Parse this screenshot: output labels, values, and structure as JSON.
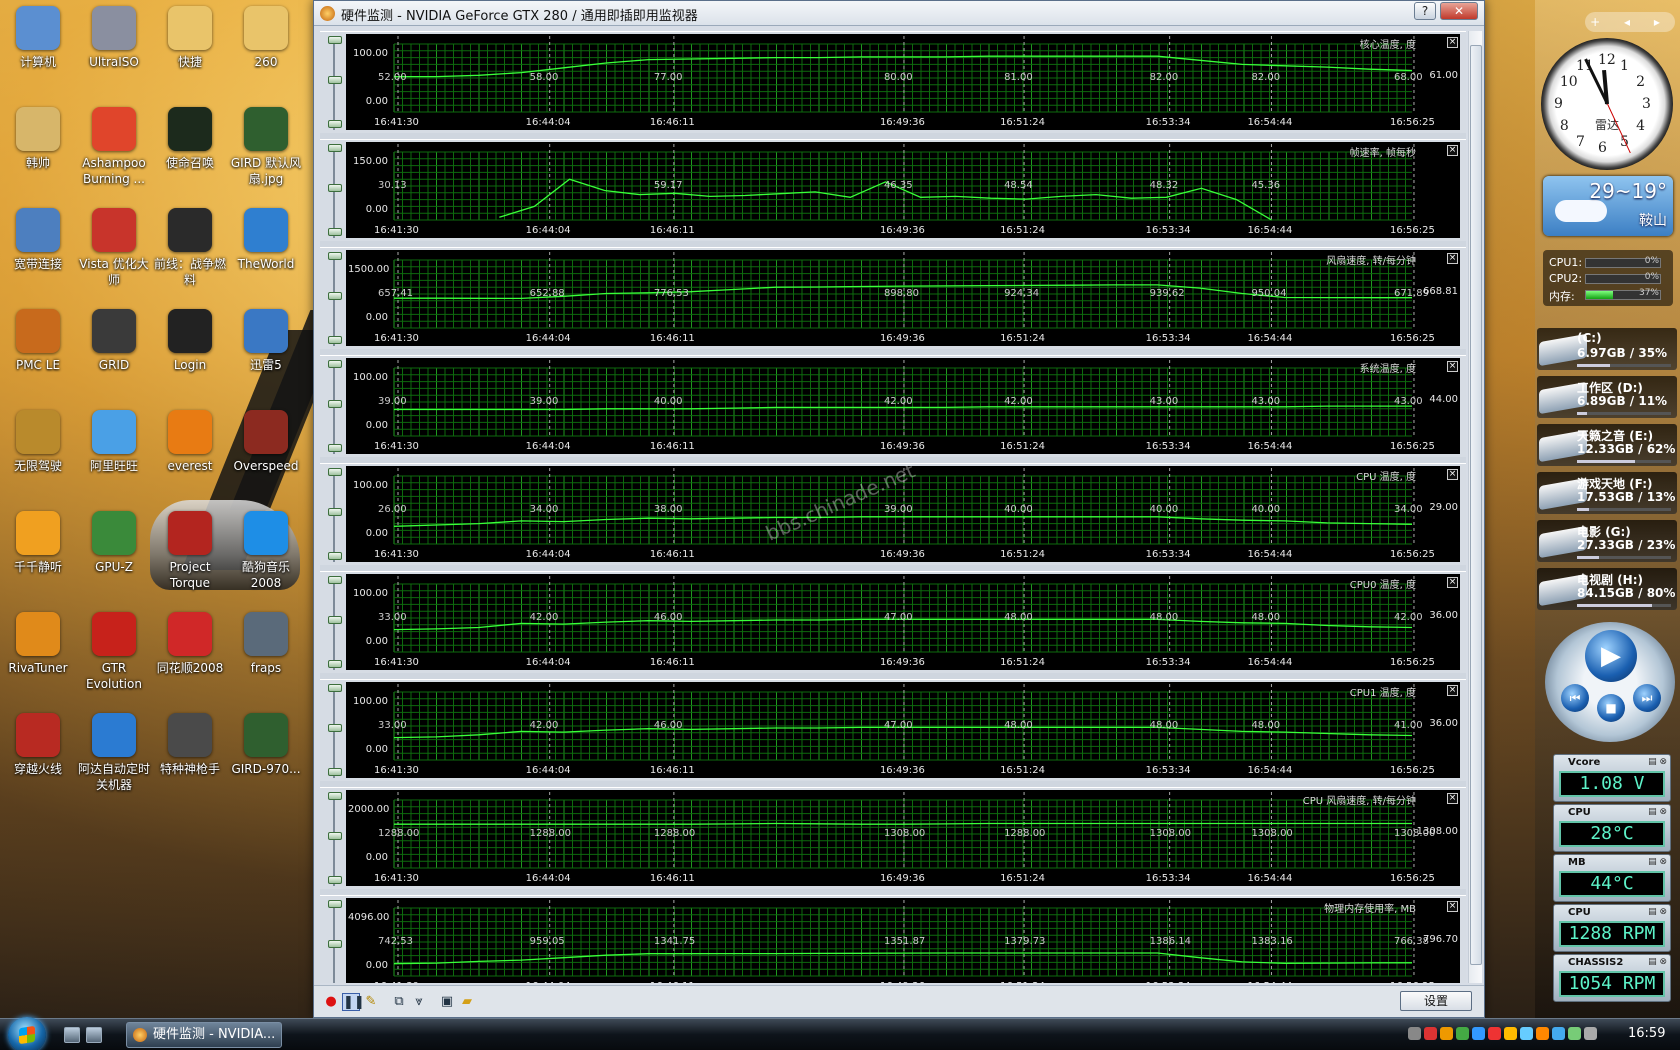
{
  "window": {
    "title": "硬件监测 - NVIDIA GeForce GTX 280 / 通用即插即用监视器",
    "help_label": "?",
    "close_label": "✕",
    "settings_label": "设置"
  },
  "x_ticks": [
    "16:41:30",
    "16:44:04",
    "16:46:11",
    "16:49:36",
    "16:51:24",
    "16:53:34",
    "16:54:44",
    "16:56:25"
  ],
  "panels": [
    {
      "label": "核心温度, 度",
      "ymax": "100.00",
      "ymin": "0.00",
      "max_value": 100,
      "last": "61.00",
      "values": [
        "52.00",
        "58.00",
        "77.00",
        "80.00",
        "81.00",
        "82.00",
        "82.00",
        "68.00"
      ],
      "series": [
        52,
        52,
        54,
        58,
        65,
        72,
        77,
        78,
        79,
        80,
        80,
        81,
        81,
        81,
        82,
        82,
        82,
        82,
        82,
        76,
        70,
        68,
        66,
        63,
        61
      ]
    },
    {
      "label": "帧速率, 帧每秒",
      "ymax": "150.00",
      "ymin": "0.00",
      "max_value": 150,
      "last": "",
      "values": [
        "30.13",
        "",
        "59.17",
        "46.35",
        "48.54",
        "48.32",
        "45.36",
        ""
      ],
      "series": [
        null,
        null,
        null,
        6,
        30,
        90,
        65,
        56,
        59,
        52,
        54,
        58,
        62,
        50,
        84,
        50,
        52,
        48,
        46,
        52,
        56,
        48,
        50,
        70,
        45,
        0,
        null,
        null,
        null,
        null
      ]
    },
    {
      "label": "风扇速度, 转/每分钟",
      "ymax": "1500.00",
      "ymin": "0.00",
      "max_value": 1500,
      "last": "668.81",
      "values": [
        "657.41",
        "652.88",
        "776.53",
        "898.80",
        "924.34",
        "939.62",
        "950.04",
        "671.89"
      ],
      "series": [
        657,
        657,
        655,
        652,
        700,
        760,
        776,
        800,
        850,
        899,
        905,
        915,
        924,
        928,
        935,
        940,
        945,
        950,
        950,
        880,
        760,
        672,
        670,
        669,
        669
      ]
    },
    {
      "label": "系统温度, 度",
      "ymax": "100.00",
      "ymin": "0.00",
      "max_value": 100,
      "last": "44.00",
      "values": [
        "39.00",
        "39.00",
        "40.00",
        "42.00",
        "42.00",
        "43.00",
        "43.00",
        "43.00"
      ],
      "series": [
        39,
        39,
        39,
        39,
        39,
        40,
        40,
        40,
        41,
        42,
        42,
        42,
        42,
        42,
        43,
        43,
        43,
        43,
        43,
        43,
        43,
        43,
        44,
        44,
        44
      ]
    },
    {
      "label": "CPU 温度, 度",
      "ymax": "100.00",
      "ymin": "0.00",
      "max_value": 100,
      "last": "29.00",
      "values": [
        "26.00",
        "34.00",
        "38.00",
        "39.00",
        "40.00",
        "40.00",
        "40.00",
        "34.00"
      ],
      "series": [
        26,
        28,
        30,
        34,
        33,
        36,
        38,
        37,
        38,
        39,
        39,
        40,
        40,
        40,
        40,
        40,
        40,
        40,
        40,
        37,
        35,
        34,
        31,
        30,
        29
      ]
    },
    {
      "label": "CPU0 温度, 度",
      "ymax": "100.00",
      "ymin": "0.00",
      "max_value": 100,
      "last": "36.00",
      "values": [
        "33.00",
        "42.00",
        "46.00",
        "47.00",
        "48.00",
        "48.00",
        "48.00",
        "42.00"
      ],
      "series": [
        33,
        34,
        36,
        42,
        41,
        44,
        46,
        45,
        46,
        47,
        47,
        48,
        48,
        48,
        48,
        48,
        48,
        48,
        48,
        45,
        43,
        42,
        39,
        37,
        36
      ]
    },
    {
      "label": "CPU1 温度, 度",
      "ymax": "100.00",
      "ymin": "0.00",
      "max_value": 100,
      "last": "36.00",
      "values": [
        "33.00",
        "42.00",
        "46.00",
        "47.00",
        "48.00",
        "48.00",
        "48.00",
        "41.00"
      ],
      "series": [
        33,
        34,
        37,
        42,
        41,
        44,
        46,
        45,
        46,
        47,
        47,
        48,
        48,
        48,
        48,
        48,
        48,
        48,
        48,
        45,
        42,
        41,
        39,
        37,
        36
      ]
    },
    {
      "label": "CPU 风扇速度, 转/每分钟",
      "ymax": "2000.00",
      "ymin": "0.00",
      "max_value": 2000,
      "last": "1308.00",
      "values": [
        "1288.00",
        "1288.00",
        "1288.00",
        "1308.00",
        "1288.00",
        "1308.00",
        "1308.00",
        "1308.00"
      ],
      "series": [
        1288,
        1288,
        1288,
        1288,
        1288,
        1288,
        1288,
        1288,
        1298,
        1308,
        1300,
        1288,
        1288,
        1298,
        1308,
        1308,
        1308,
        1308,
        1308,
        1308,
        1308,
        1308,
        1308,
        1308,
        1308
      ]
    },
    {
      "label": "物理内存使用率, MB",
      "ymax": "4096.00",
      "ymin": "0.00",
      "max_value": 4096,
      "last": "796.70",
      "values": [
        "742.53",
        "959.05",
        "1341.75",
        "1351.87",
        "1379.73",
        "1386.14",
        "1383.16",
        "766.38"
      ],
      "series": [
        742,
        780,
        880,
        959,
        1100,
        1250,
        1341,
        1345,
        1348,
        1352,
        1360,
        1370,
        1380,
        1383,
        1385,
        1386,
        1386,
        1383,
        1383,
        1100,
        850,
        766,
        780,
        790,
        797
      ]
    }
  ],
  "watermark": "bbs.chinade.net",
  "desktop_icons": [
    {
      "label": "计算机",
      "icon": "computer-icon",
      "color": "#5b8fd1"
    },
    {
      "label": "UltraISO",
      "icon": "disc-icon",
      "color": "#8a8fa0"
    },
    {
      "label": "快捷",
      "icon": "folder-icon",
      "color": "#e9c46a"
    },
    {
      "label": "260",
      "icon": "folder-icon",
      "color": "#e9c46a"
    },
    {
      "label": "韩帅",
      "icon": "folder-icon",
      "color": "#d7b66a"
    },
    {
      "label": "Ashampoo Burning ...",
      "icon": "burner-icon",
      "color": "#e0452b"
    },
    {
      "label": "使命召唤",
      "icon": "game-cod4-icon",
      "color": "#1c2a1c"
    },
    {
      "label": "GIRD 默认风扇.jpg",
      "icon": "image-file-icon",
      "color": "#2f5f2f"
    },
    {
      "label": "宽带连接",
      "icon": "network-icon",
      "color": "#4d7fbf"
    },
    {
      "label": "Vista 优化大师",
      "icon": "tools-icon",
      "color": "#c8342b"
    },
    {
      "label": "前线：战争燃料",
      "icon": "game-ffow-icon",
      "color": "#2a2a2a"
    },
    {
      "label": "TheWorld",
      "icon": "browser-icon",
      "color": "#2f7fd0"
    },
    {
      "label": "PMC LE",
      "icon": "pmc-icon",
      "color": "#c86a1c"
    },
    {
      "label": "GRID",
      "icon": "game-grid-icon",
      "color": "#3a3a3a"
    },
    {
      "label": "Login",
      "icon": "qq-icon",
      "color": "#222"
    },
    {
      "label": "迅雷5",
      "icon": "thunder-icon",
      "color": "#3a78c4"
    },
    {
      "label": "无限驾驶",
      "icon": "game-drive-icon",
      "color": "#b98a2c"
    },
    {
      "label": "阿里旺旺",
      "icon": "wangwang-icon",
      "color": "#4aa0e6"
    },
    {
      "label": "everest",
      "icon": "info-icon",
      "color": "#e87b13"
    },
    {
      "label": "Overspeed",
      "icon": "engine-icon",
      "color": "#8c2a20"
    },
    {
      "label": "千千静听",
      "icon": "headphone-icon",
      "color": "#f0a020"
    },
    {
      "label": "GPU-Z",
      "icon": "gpu-icon",
      "color": "#3a8a3a"
    },
    {
      "label": "Project Torque",
      "icon": "car-icon",
      "color": "#b3251f"
    },
    {
      "label": "酷狗音乐 2008",
      "icon": "kugou-icon",
      "color": "#1e8ee6"
    },
    {
      "label": "RivaTuner",
      "icon": "gear-icon",
      "color": "#e08a1a"
    },
    {
      "label": "GTR Evolution",
      "icon": "gtr-icon",
      "color": "#c7221b"
    },
    {
      "label": "同花顺2008",
      "icon": "cards-icon",
      "color": "#d02828"
    },
    {
      "label": "fraps",
      "icon": "fraps-icon",
      "color": "#5a6a7a"
    },
    {
      "label": "穿越火线",
      "icon": "crossfire-icon",
      "color": "#b82a22"
    },
    {
      "label": "阿达自动定时关机器",
      "icon": "shutdown-icon",
      "color": "#2b7bd2"
    },
    {
      "label": "特种神枪手",
      "icon": "sniper-icon",
      "color": "#4a4a4a"
    },
    {
      "label": "GIRD-970...",
      "icon": "image-file-icon",
      "color": "#2f5f2f"
    }
  ],
  "sidebar": {
    "toolbar": "+ ◂ ▸",
    "clock_city": "雷达",
    "clock_numbers": [
      "12",
      "1",
      "2",
      "3",
      "4",
      "5",
      "6",
      "7",
      "8",
      "9",
      "10",
      "11"
    ],
    "weather_temp": "29~19°",
    "weather_city": "鞍山",
    "meters": [
      {
        "label": "CPU1:",
        "pct": "0%",
        "level": 0
      },
      {
        "label": "CPU2:",
        "pct": "0%",
        "level": 0
      },
      {
        "label": "内存:",
        "pct": "37%",
        "level": 37
      }
    ],
    "drives": [
      {
        "name": "(C:)",
        "info": "6.97GB / 35%",
        "level": 35
      },
      {
        "name": "工作区 (D:)",
        "info": "6.89GB / 11%",
        "level": 11
      },
      {
        "name": "天籁之音 (E:)",
        "info": "12.33GB / 62%",
        "level": 62
      },
      {
        "name": "游戏天地 (F:)",
        "info": "17.53GB / 13%",
        "level": 13
      },
      {
        "name": "电影 (G:)",
        "info": "27.33GB / 23%",
        "level": 23
      },
      {
        "name": "电视剧 (H:)",
        "info": "84.15GB / 80%",
        "level": 80
      }
    ],
    "sensors": [
      {
        "title": "Vcore",
        "value": "1.08 V"
      },
      {
        "title": "CPU",
        "value": "28°C"
      },
      {
        "title": "MB",
        "value": "44°C"
      },
      {
        "title": "CPU",
        "value": "1288 RPM"
      },
      {
        "title": "CHASSIS2",
        "value": "1054 RPM"
      }
    ]
  },
  "taskbar": {
    "task_label": "硬件监测 - NVIDIA...",
    "clock": "16:59"
  },
  "colors": {
    "graph_line": "#39ff39",
    "grid": "#0e6a0e",
    "grid_major": "#1f9a1f"
  }
}
